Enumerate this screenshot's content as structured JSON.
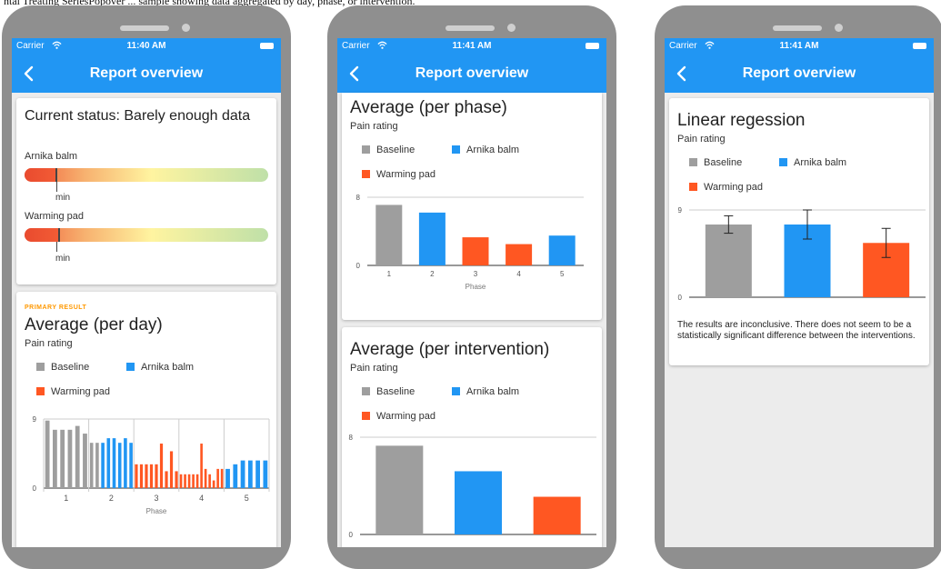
{
  "caption": "ntal Treating SeriesPopover ... sample showing data aggregated by day, phase, or intervention.",
  "colors": {
    "Baseline": "#9e9e9e",
    "Arnika balm": "#2196f3",
    "Warming pad": "#ff5722",
    "app_bar": "#2196f3",
    "primary_result": "#ff9800"
  },
  "phones": [
    {
      "status": {
        "carrier": "Carrier",
        "time": "11:40 AM"
      },
      "header": {
        "title": "Report overview",
        "back_icon": "chevron-left-icon"
      },
      "status_card": {
        "title": "Current status: Barely enough data",
        "bars": [
          {
            "label": "Arnika balm",
            "min_label": "min",
            "fill_fraction": 0.13
          },
          {
            "label": "Warming pad",
            "min_label": "min",
            "fill_fraction": 0.14
          }
        ]
      },
      "day_card": {
        "primary_label": "PRIMARY RESULT",
        "title": "Average (per day)",
        "subtitle": "Pain rating",
        "legend": [
          "Baseline",
          "Arnika balm",
          "Warming pad"
        ]
      }
    },
    {
      "status": {
        "carrier": "Carrier",
        "time": "11:41 AM"
      },
      "header": {
        "title": "Report overview",
        "back_icon": "chevron-left-icon"
      },
      "phase_card": {
        "title": "Average (per phase)",
        "subtitle": "Pain rating",
        "legend": [
          "Baseline",
          "Arnika balm",
          "Warming pad"
        ]
      },
      "intervention_card": {
        "title": "Average (per intervention)",
        "subtitle": "Pain rating",
        "legend": [
          "Baseline",
          "Arnika balm",
          "Warming pad"
        ]
      }
    },
    {
      "status": {
        "carrier": "Carrier",
        "time": "11:41 AM"
      },
      "header": {
        "title": "Report overview",
        "back_icon": "chevron-left-icon"
      },
      "regression_card": {
        "title": "Linear regession",
        "subtitle": "Pain rating",
        "legend": [
          "Baseline",
          "Arnika balm",
          "Warming pad"
        ],
        "results_text": "The results are inconclusive. There does not seem to be a statistically significant difference between the interventions."
      }
    }
  ],
  "chart_data": [
    {
      "id": "per-day",
      "type": "bar",
      "xlabel": "Phase",
      "ylabel": "",
      "ylim": [
        0,
        9
      ],
      "yticks": [
        0,
        9
      ],
      "phases": [
        "1",
        "2",
        "3",
        "4",
        "5"
      ],
      "series_by_bar": [
        {
          "name": "Baseline",
          "phase": 1,
          "values": [
            8.8,
            7.6,
            7.6,
            7.6,
            8.1,
            7.1
          ]
        },
        {
          "name": "Baseline",
          "phase": 2,
          "values": [
            5.9,
            5.9
          ]
        },
        {
          "name": "Arnika balm",
          "phase": 2,
          "values": [
            5.9,
            6.5,
            6.5,
            5.9,
            6.5,
            5.9
          ]
        },
        {
          "name": "Warming pad",
          "phase": 3,
          "values": [
            3.1,
            3.1,
            3.1,
            3.1,
            3.1,
            5.8,
            2.2,
            4.8,
            2.2
          ]
        },
        {
          "name": "Warming pad",
          "phase": 4,
          "values": [
            1.8,
            1.8,
            1.8,
            1.8,
            1.8,
            5.8,
            2.5,
            1.8,
            1.0,
            2.5,
            2.5
          ]
        },
        {
          "name": "Arnika balm",
          "phase": 5,
          "values": [
            2.5,
            3.1,
            3.6,
            3.6,
            3.6,
            3.6
          ]
        }
      ]
    },
    {
      "id": "per-phase",
      "type": "bar",
      "xlabel": "Phase",
      "ylabel": "",
      "ylim": [
        0,
        8
      ],
      "yticks": [
        0,
        8
      ],
      "categories": [
        "1",
        "2",
        "3",
        "4",
        "5"
      ],
      "values": [
        7.1,
        6.2,
        3.3,
        2.5,
        3.5
      ],
      "series": [
        "Baseline",
        "Arnika balm",
        "Warming pad",
        "Warming pad",
        "Arnika balm"
      ]
    },
    {
      "id": "per-intervention",
      "type": "bar",
      "xlabel": "",
      "ylabel": "",
      "ylim": [
        0,
        8
      ],
      "yticks": [
        0,
        8
      ],
      "categories": [
        "Baseline",
        "Arnika balm",
        "Warming pad"
      ],
      "values": [
        7.3,
        5.2,
        3.1
      ]
    },
    {
      "id": "regression",
      "type": "bar",
      "xlabel": "",
      "ylabel": "",
      "ylim": [
        0,
        9
      ],
      "yticks": [
        0,
        9
      ],
      "categories": [
        "Baseline",
        "Arnika balm",
        "Warming pad"
      ],
      "values": [
        7.5,
        7.5,
        5.6
      ],
      "error_low": [
        6.6,
        6.0,
        4.1
      ],
      "error_high": [
        8.4,
        9.0,
        7.1
      ]
    }
  ]
}
